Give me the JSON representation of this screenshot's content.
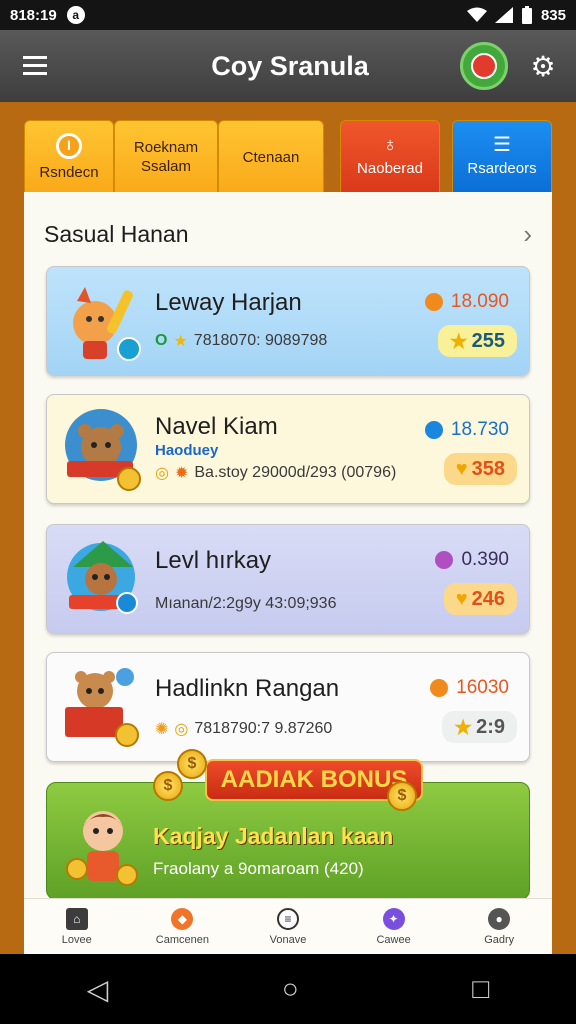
{
  "status_bar": {
    "time": "818:19",
    "battery": "835"
  },
  "app_bar": {
    "title": "Coy Sranula"
  },
  "tabs": [
    {
      "label": "Rsndecn",
      "color": "#ffc531"
    },
    {
      "label": "Roeknam Ssalam",
      "color": "#ffc531"
    },
    {
      "label": "Ctenaan",
      "color": "#ffc531"
    },
    {
      "label": "Naoberad",
      "color": "#f0572c"
    },
    {
      "label": "Rsardeors",
      "color": "#1d8ef2"
    }
  ],
  "section": {
    "title": "Sasual Hanan"
  },
  "cards": [
    {
      "name": "Leway Harjan",
      "meta": "7818070: 9089798",
      "score": "18.090",
      "badge": "255"
    },
    {
      "name": "Navel Kiam",
      "tag": "Haoduey",
      "meta": "Ba.stoy 29000d/293 (00796)",
      "score": "18.730",
      "badge": "358"
    },
    {
      "name": "Levl hırkay",
      "meta": "Mıanan/2:2g9y 43:09;936",
      "score": "0.390",
      "badge": "246"
    },
    {
      "name": "Hadlinkn Rangan",
      "meta": "7818790:7 9.87260",
      "score": "16030",
      "badge": "2:9"
    }
  ],
  "bonus": {
    "banner": "AADIAK BONUS",
    "title": "Kaqjay Jadanlan kaan",
    "subtitle": "Fraolany a 9omaroam (420)"
  },
  "bottom_nav": [
    {
      "label": "Lovee"
    },
    {
      "label": "Camcenen"
    },
    {
      "label": "Vonave"
    },
    {
      "label": "Cawee"
    },
    {
      "label": "Gadry"
    }
  ],
  "colors": {
    "accent_orange": "#f0572c",
    "accent_blue": "#1d8ef2",
    "tab_yellow": "#ffc531",
    "bonus_green": "#7fbf3a"
  }
}
